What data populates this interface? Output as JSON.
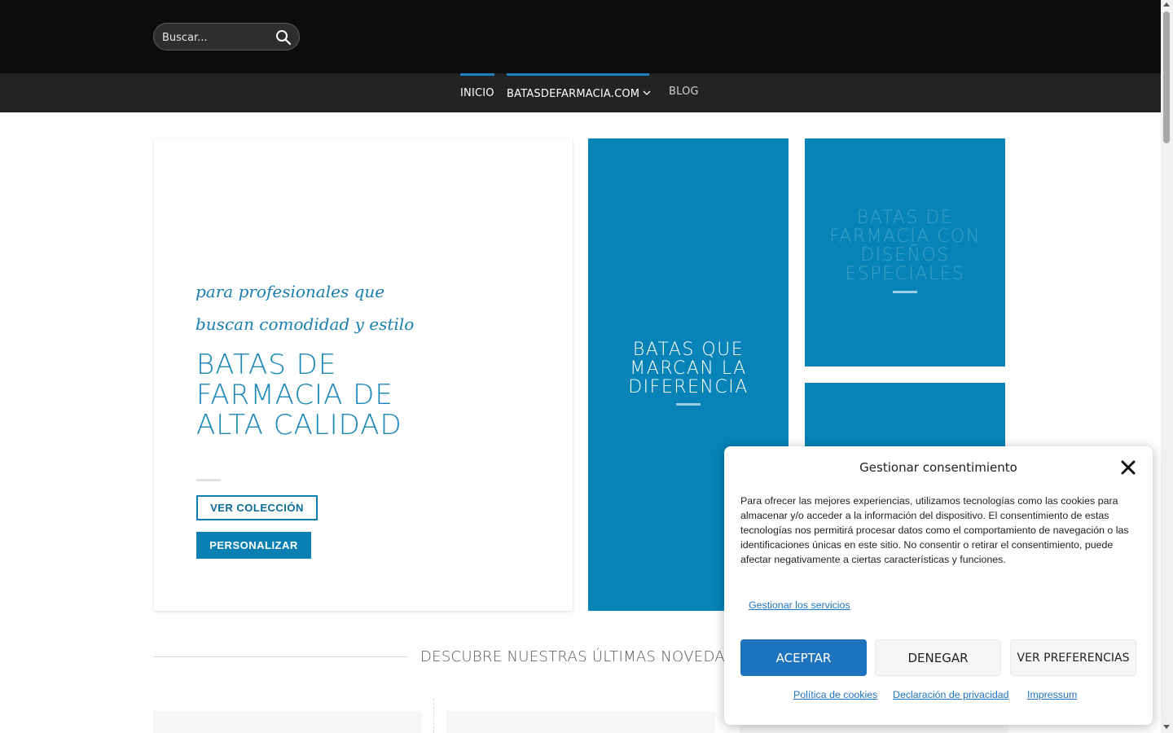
{
  "header": {
    "search": {
      "placeholder": "Buscar...",
      "icon": "search-icon"
    },
    "nav": [
      {
        "label": "INICIO",
        "active": true
      },
      {
        "label": "BATASDEFARMACIA.COM",
        "active": true,
        "has_dropdown": true
      },
      {
        "label": "BLOG",
        "active": false
      }
    ]
  },
  "hero": {
    "tagline": "para profesionales que buscan comodidad y estilo",
    "title": "BATAS DE FARMACIA DE ALTA CALIDAD",
    "btn_collection": "VER COLECCIÓN",
    "btn_customize": "PERSONALIZAR"
  },
  "tiles": [
    {
      "label": "BATAS QUE MARCAN LA DIFERENCIA"
    },
    {
      "label": "BATAS DE FARMACIA CON DISEÑOS ESPECIALES"
    }
  ],
  "section": {
    "title": "DESCUBRE NUESTRAS ÚLTIMAS NOVEDADES"
  },
  "consent": {
    "title": "Gestionar consentimiento",
    "body": "Para ofrecer las mejores experiencias, utilizamos tecnologías como las cookies para almacenar y/o acceder a la información del dispositivo. El consentimiento de estas tecnologías nos permitirá procesar datos como el comportamiento de navegación o las identificaciones únicas en este sitio. No consentir o retirar el consentimiento, puede afectar negativamente a ciertas características y funciones.",
    "manage_services": "Gestionar los servicios",
    "accept": "ACEPTAR",
    "deny": "DENEGAR",
    "preferences": "VER PREFERENCIAS",
    "links": {
      "cookie_policy": "Política de cookies",
      "privacy": "Declaración de privacidad",
      "impressum": "Impressum"
    }
  },
  "colors": {
    "brand_blue": "#0783b8",
    "accept_blue": "#1e73be",
    "header_bg": "#0c0c0c",
    "nav_bg": "#232323"
  }
}
